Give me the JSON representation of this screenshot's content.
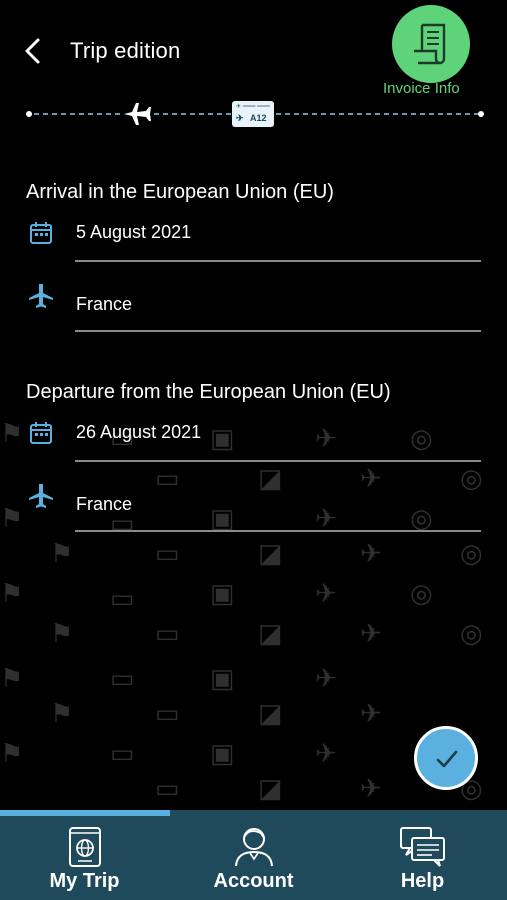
{
  "header": {
    "title": "Trip edition",
    "back_icon": "chevron-left-icon",
    "invoice_label": "Invoice Info",
    "invoice_icon": "receipt-icon"
  },
  "progress": {
    "step_icons": [
      "airplane-icon",
      "boarding-pass-icon"
    ],
    "ticket_text": "A12"
  },
  "arrival": {
    "title": "Arrival in the European Union (EU)",
    "date": "5 August 2021",
    "country": "France"
  },
  "departure": {
    "title": "Departure from the European Union (EU)",
    "date": "26 August 2021",
    "country": "France"
  },
  "confirm_icon": "checkmark-icon",
  "nav": {
    "items": [
      {
        "label": "My Trip",
        "icon": "passport-icon"
      },
      {
        "label": "Account",
        "icon": "user-icon"
      },
      {
        "label": "Help",
        "icon": "chat-icon"
      }
    ],
    "active_index": 0
  },
  "colors": {
    "accent": "#5ab1e0",
    "invoice_green": "#5fd37a",
    "nav_bg": "#1f4a5c",
    "background": "#000000"
  }
}
